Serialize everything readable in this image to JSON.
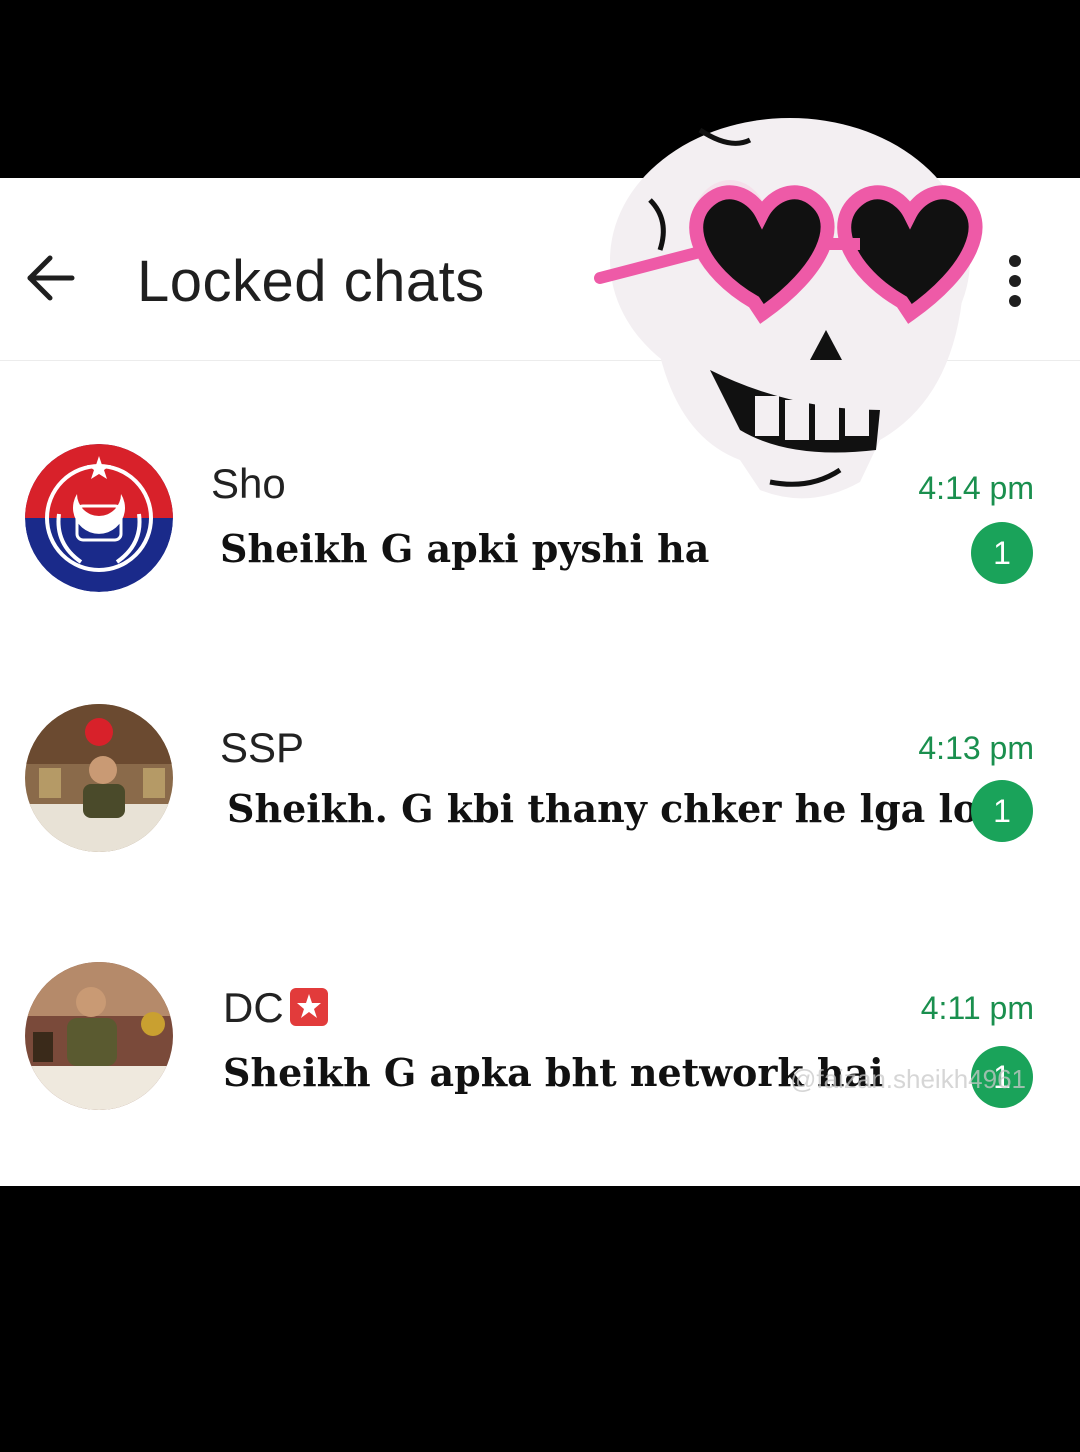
{
  "header": {
    "title": "Locked chats"
  },
  "chats": [
    {
      "name": "Sho",
      "message": "Sheikh  G  apki  pyshi  ha",
      "time": "4:14 pm",
      "unread": "1"
    },
    {
      "name": "SSP",
      "message": "Sheikh. G  kbi thany  chker he lga lo",
      "time": "4:13 pm",
      "unread": "1"
    },
    {
      "name": "DC",
      "message": "Sheikh  G apka  bht network  hai",
      "time": "4:11 pm",
      "unread": "1"
    }
  ],
  "watermark": "@faizan.sheikh4961",
  "colors": {
    "accent_green": "#1aa35a",
    "time_green": "#1a8f4e",
    "background": "#ffffff",
    "letterbox": "#000000"
  },
  "icons": {
    "back": "back-arrow-icon",
    "menu": "more-vertical-icon",
    "sticker": "skull-heart-glasses-sticker"
  }
}
